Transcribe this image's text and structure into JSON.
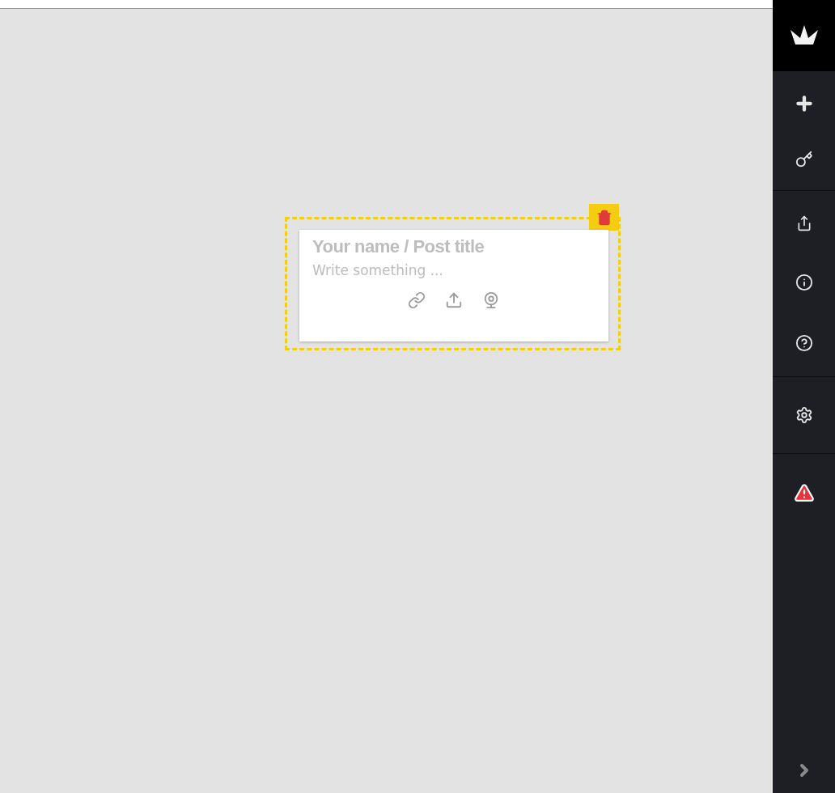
{
  "card": {
    "title": {
      "placeholder": "Your name / Post title"
    },
    "body": {
      "placeholder": "Write something ..."
    }
  }
}
